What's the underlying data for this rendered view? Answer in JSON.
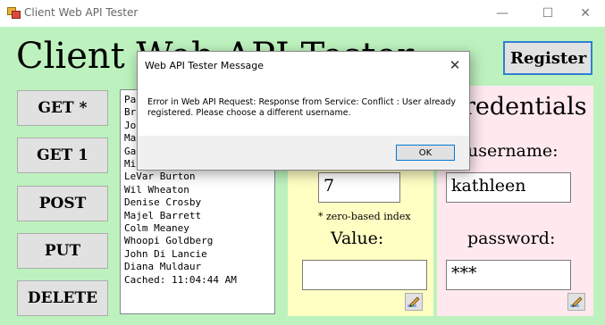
{
  "window": {
    "title": "Client Web API Tester",
    "minimize": "—",
    "maximize": "☐",
    "close": "✕"
  },
  "app": {
    "heading": "Client Web API Tester",
    "register_label": "Register"
  },
  "verbs": {
    "get_all": "GET *",
    "get_one": "GET 1",
    "post": "POST",
    "put": "PUT",
    "delete": "DELETE"
  },
  "results": {
    "items": [
      "Pa",
      "Br",
      "Jo",
      "Ma",
      "Ga",
      "Mi",
      "LeVar Burton",
      "Wil Wheaton",
      "Denise Crosby",
      "Majel Barrett",
      "Colm Meaney",
      "Whoopi Goldberg",
      "John Di Lancie",
      "Diana Muldaur",
      "Cached: 11:04:44 AM"
    ]
  },
  "index_panel": {
    "index_value": "7",
    "index_note": "* zero-based index",
    "value_label": "Value:",
    "value_value": ""
  },
  "credentials": {
    "heading": "redentials",
    "username_label": "username:",
    "username_value": "kathleen",
    "password_label": "password:",
    "password_value": "***"
  },
  "dialog": {
    "title": "Web API Tester Message",
    "close": "✕",
    "message": "Error in Web API Request: Response from Service: Conflict : User already registered. Please choose a different username.",
    "ok_label": "OK"
  },
  "icons": {
    "app": "app-icon",
    "edit": "pencil-icon"
  },
  "colors": {
    "client_bg": "#bdf2be",
    "index_panel_bg": "#ffffc4",
    "credentials_panel_bg": "#ffe9ee",
    "accent": "#2f7fd1"
  }
}
